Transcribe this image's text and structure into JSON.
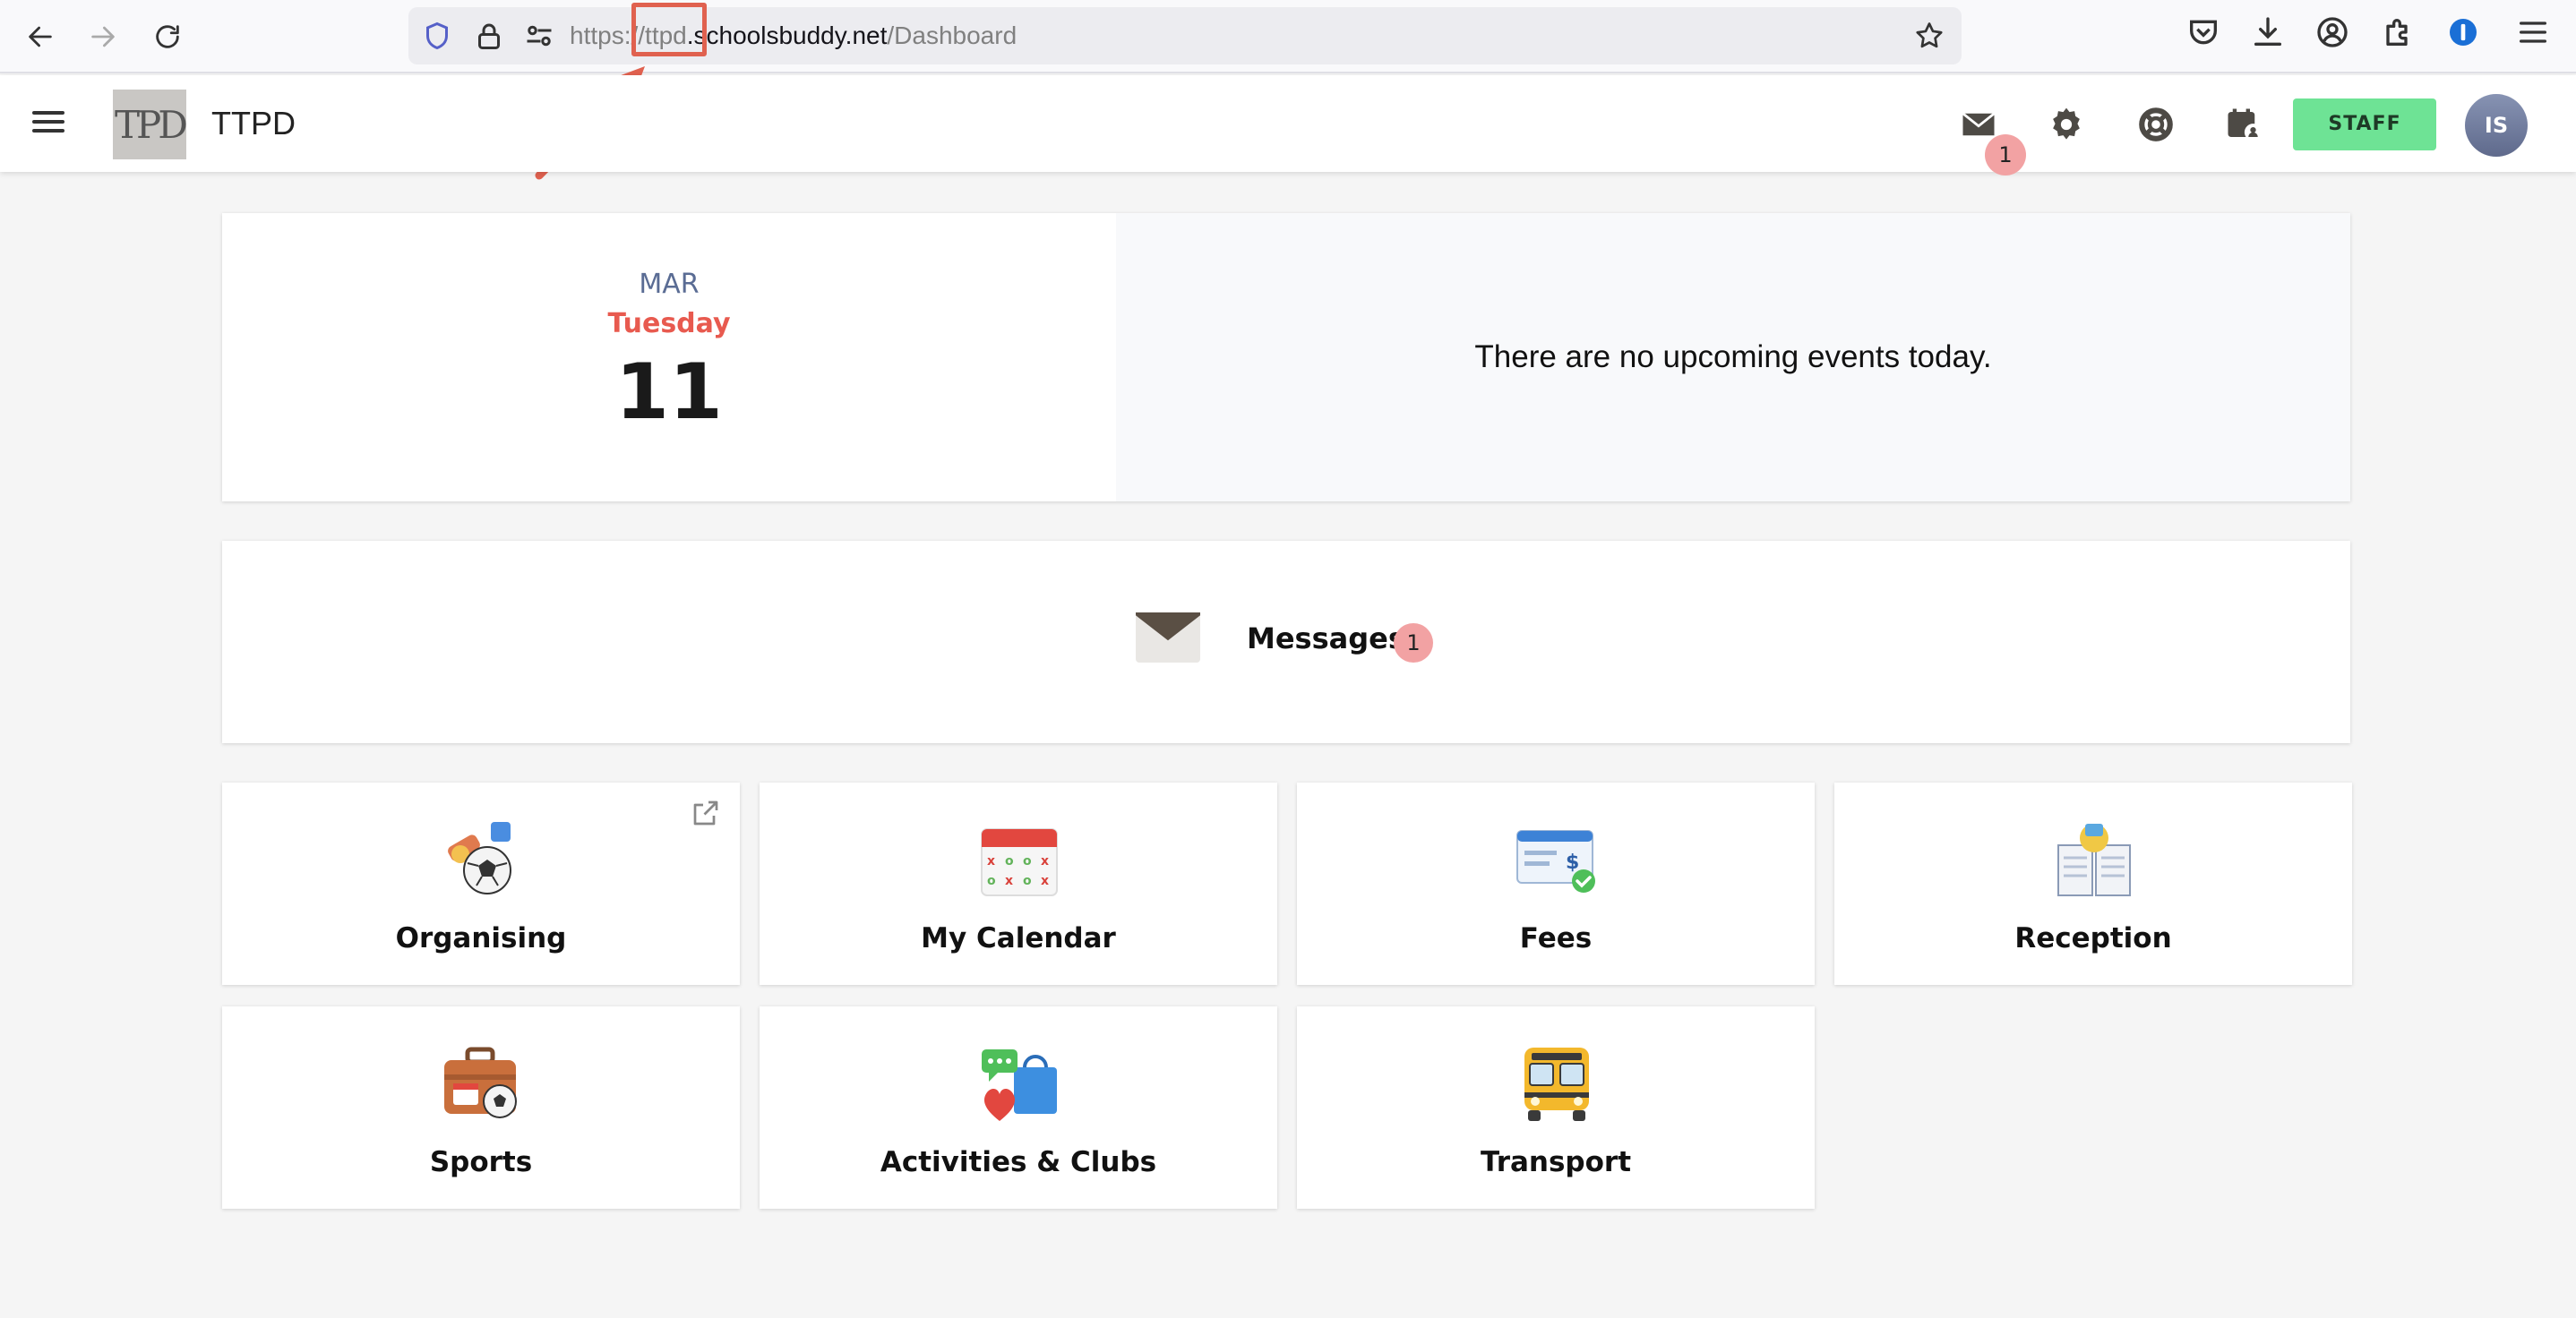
{
  "browser": {
    "url_scheme": "https://",
    "url_subdomain": "ttpd",
    "url_host": ".schoolsbuddy.net",
    "url_path": "/Dashboard"
  },
  "header": {
    "app_name": "TTPD",
    "logo_text": "TPD",
    "messages_badge": "1",
    "staff_label": "STAFF",
    "avatar_initials": "IS"
  },
  "today": {
    "month": "MAR",
    "weekday": "Tuesday",
    "day": "11",
    "events_text": "There are no upcoming events today."
  },
  "messages": {
    "label": "Messages",
    "count": "1"
  },
  "tiles": [
    {
      "label": "Organising"
    },
    {
      "label": "My Calendar"
    },
    {
      "label": "Fees"
    },
    {
      "label": "Reception"
    },
    {
      "label": "Sports"
    },
    {
      "label": "Activities & Clubs"
    },
    {
      "label": "Transport"
    }
  ],
  "colors": {
    "accent_red": "#e85a4f",
    "staff_green": "#6ee395",
    "badge_pink": "#f2a2a3",
    "annotation": "#e0614f"
  }
}
